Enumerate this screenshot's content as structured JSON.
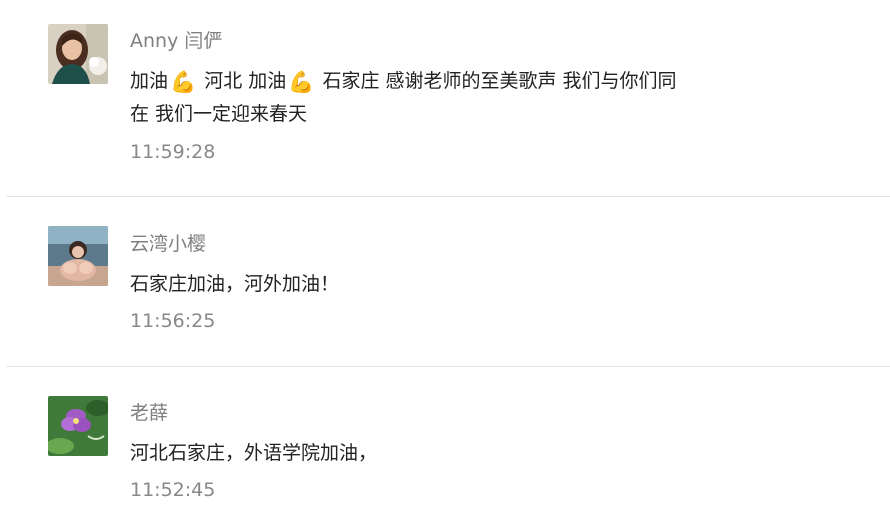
{
  "comments": [
    {
      "author": "Anny 闫俨",
      "content_line1": [
        "加油",
        "河北 加油",
        "石家庄 感谢老师的至美歌声 我们与你们同"
      ],
      "content_line2": "在 我们一定迎来春天",
      "emoji": "💪",
      "avatar_icon": "avatar-woman-portrait",
      "time": "11:59:28"
    },
    {
      "author": "云湾小樱",
      "content": "石家庄加油，河外加油！",
      "avatar_icon": "avatar-girl-sitting",
      "time": "11:56:25"
    },
    {
      "author": "老薛",
      "content": "河北石家庄，外语学院加油，",
      "avatar_icon": "avatar-purple-flower",
      "time": "11:52:45"
    }
  ]
}
